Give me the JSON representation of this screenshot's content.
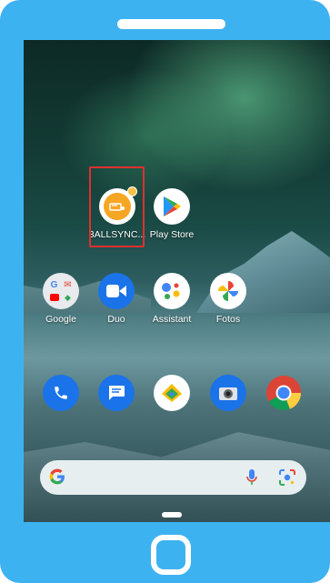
{
  "apps_row1": [
    {
      "label": "3ALLSYNC...",
      "icon": "3allsync-app-icon",
      "color": "#f6a623"
    },
    {
      "label": "Play Store",
      "icon": "play-store-icon"
    }
  ],
  "apps_row2": [
    {
      "label": "Google",
      "icon": "google-folder-icon"
    },
    {
      "label": "Duo",
      "icon": "duo-video-icon",
      "color": "#1a73e8"
    },
    {
      "label": "Assistant",
      "icon": "assistant-icon"
    },
    {
      "label": "Fotos",
      "icon": "photos-pinwheel-icon"
    }
  ],
  "dock": [
    {
      "icon": "phone-icon",
      "color": "#1a73e8"
    },
    {
      "icon": "messages-icon",
      "color": "#1a73e8"
    },
    {
      "icon": "files-icon"
    },
    {
      "icon": "camera-icon",
      "color": "#1a73e8"
    },
    {
      "icon": "chrome-icon"
    }
  ],
  "search": {
    "logo": "google-g-icon",
    "mic": "mic-icon",
    "lens": "lens-icon"
  },
  "colors": {
    "frame": "#3db2f0",
    "highlight": "#e0302f"
  }
}
